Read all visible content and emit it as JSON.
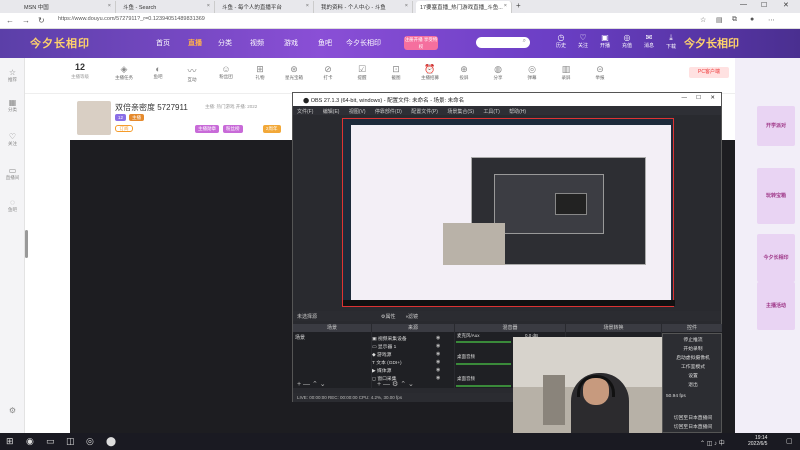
{
  "browser": {
    "tabs": [
      {
        "label": "MSN 中国"
      },
      {
        "label": "斗鱼 - Search"
      },
      {
        "label": "斗鱼 - 每个人的直播平台"
      },
      {
        "label": "我的资料 - 个人中心 - 斗鱼"
      },
      {
        "label": "17要塞直播_热门游戏直播_斗鱼..."
      }
    ],
    "url": "https://www.douyu.com/5727911?_r=0.12394051489831369"
  },
  "site": {
    "logo": "今夕长相印",
    "nav": [
      "首页",
      "直播",
      "分类",
      "视频",
      "游戏",
      "鱼吧",
      "今夕长相印"
    ],
    "nav_active": "直播",
    "register_btn": "注册开播 享受特权",
    "header_icons": [
      "历史",
      "关注",
      "开播",
      "充值",
      "消息",
      "下载",
      "客户端"
    ],
    "logo2": "今夕长相印"
  },
  "sidebar": [
    "推荐",
    "分类",
    "关注",
    "直播间",
    "鱼吧"
  ],
  "toolstrip": {
    "level": "12",
    "level_sub": "主播等级",
    "tools": [
      "主播任务",
      "鱼吧",
      "互动",
      "粉丝团",
      "礼物",
      "星光宝箱",
      "打卡",
      "提醒",
      "截图",
      "主播招募",
      "投屏",
      "分享",
      "弹幕",
      "录屏",
      "举报"
    ],
    "pc_button": "PC客户端"
  },
  "anchor": {
    "name": "双倍亲密度 5727911",
    "sub": "主播: 热门游戏  开播: 2022",
    "badges": [
      "12",
      "主播"
    ],
    "follow": "订阅",
    "pills": [
      "主播勋章",
      "粉丝榜",
      "2周年"
    ]
  },
  "ads": [
    "开学派对",
    "玩转宝箱",
    "今夕长相印",
    "主播活动"
  ],
  "obs": {
    "title": "OBS 27.1.3 (64-bit, windows) - 配置文件: 未命名 - 场景: 未命名",
    "menu": [
      "文件(F)",
      "编辑(E)",
      "视图(V)",
      "停靠部件(D)",
      "配置文件(P)",
      "场景集合(S)",
      "工具(T)",
      "帮助(H)"
    ],
    "source_bar_label": "未选择源",
    "source_bar_props": "属性",
    "source_bar_filter": "滤镜",
    "docks": [
      "场景",
      "来源",
      "混音器",
      "场景转换",
      "控件"
    ],
    "scene": "场景",
    "sources": [
      "视频采集设备",
      "显示器 1",
      "游戏源",
      "文本 (GDI+)",
      "媒体源",
      "窗口采集"
    ],
    "mixer": [
      "麦克风/Aux",
      "桌面音频",
      "桌面音频"
    ],
    "mixer_db": "0.0 dB",
    "status": "LIVE: 00:00:00   REC: 00:00:00   CPU: 4.2%, 30.00 fps"
  },
  "context_menu": [
    "停止推流",
    "开始录制",
    "启动虚拟摄像机",
    "工作室模式",
    "设置",
    "退出",
    "50.94 fps",
    "切回至日本直播间",
    "切回至日本直播间"
  ],
  "taskbar": {
    "time": "19:14",
    "date": "2022/6/5"
  }
}
